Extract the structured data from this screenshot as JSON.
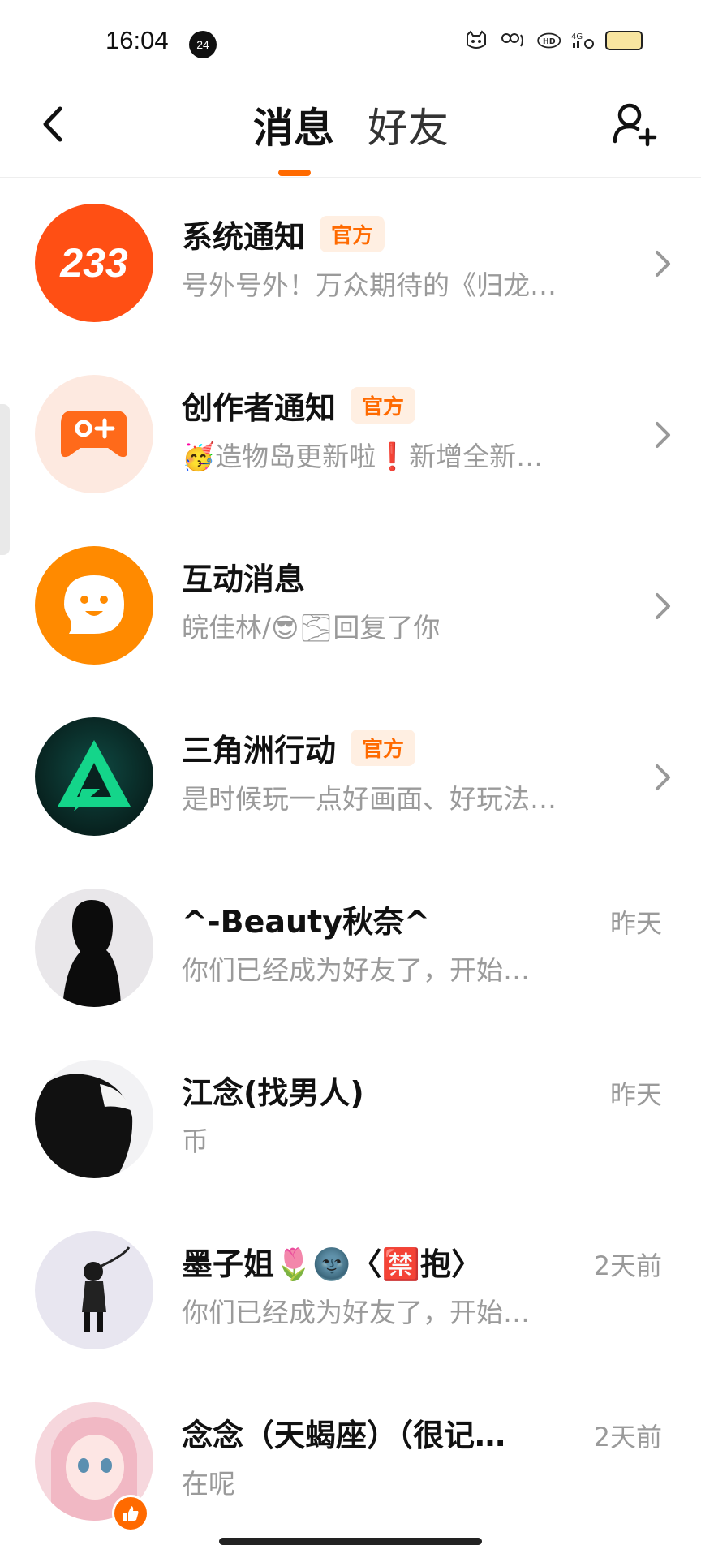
{
  "status_bar": {
    "time": "16:04",
    "notif_count": "24",
    "icons": [
      "cat-icon",
      "nfc-icon",
      "hd-call-icon",
      "signal-4g-icon",
      "battery-icon"
    ]
  },
  "header": {
    "tabs": [
      {
        "label": "消息",
        "active": true
      },
      {
        "label": "好友",
        "active": false
      }
    ]
  },
  "colors": {
    "accent": "#ff6a00",
    "muted_text": "#9a9a9a",
    "badge_bg": "#ffefe2"
  },
  "conversations": [
    {
      "name": "系统通知",
      "badge": "官方",
      "preview": "号外号外！万众期待的《归龙…",
      "trailing": "chevron",
      "avatar_text": "233"
    },
    {
      "name": "创作者通知",
      "badge": "官方",
      "preview": "🥳造物岛更新啦❗新增全新…",
      "trailing": "chevron"
    },
    {
      "name": "互动消息",
      "badge": "",
      "preview": "皖佳林/😎🌫回复了你",
      "trailing": "chevron"
    },
    {
      "name": "三角洲行动",
      "badge": "官方",
      "preview": "是时候玩一点好画面、好玩法…",
      "trailing": "chevron"
    },
    {
      "name": "^-Beauty秋奈^",
      "badge": "",
      "preview": "你们已经成为好友了，开始…",
      "time": "昨天"
    },
    {
      "name": "江念(找男人)",
      "badge": "",
      "preview": "币",
      "time": "昨天"
    },
    {
      "name": "墨子姐🌷🌚〈🈲抱〉",
      "badge": "",
      "preview": "你们已经成为好友了，开始…",
      "time": "2天前"
    },
    {
      "name": "念念（天蝎座）（很记…",
      "badge": "",
      "preview": "在呢",
      "time": "2天前"
    }
  ]
}
